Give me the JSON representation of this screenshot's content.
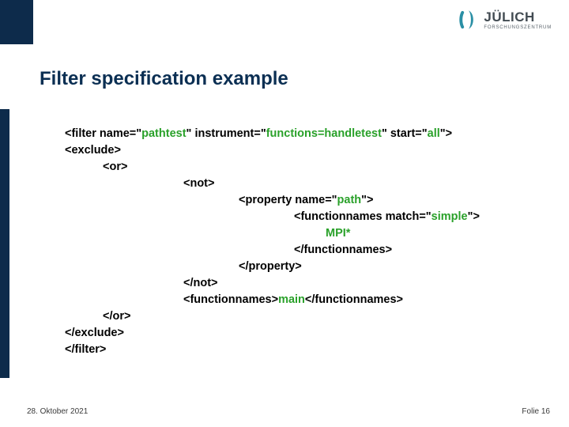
{
  "brand": {
    "name": "JÜLICH",
    "subtitle": "FORSCHUNGSZENTRUM",
    "accent_color": "#0d2b4b",
    "logo_color": "#2a8fa5"
  },
  "title": "Filter specification example",
  "code": {
    "l01a": "<filter name=\"",
    "l01b": "pathtest",
    "l01c": "\" instrument=\"",
    "l01d": "functions=handletest",
    "l01e": "\" start=\"",
    "l01f": "all",
    "l01g": "\">",
    "l02": "<exclude>",
    "l03": "<or>",
    "l04": "<not>",
    "l05a": "<property name=\"",
    "l05b": "path",
    "l05c": "\">",
    "l06a": "<functionnames match=\"",
    "l06b": "simple",
    "l06c": "\">",
    "l07": "MPI*",
    "l08": "</functionnames>",
    "l09": "</property>",
    "l10": "</not>",
    "l11a": "<functionnames>",
    "l11b": "main",
    "l11c": "</functionnames>",
    "l12": "</or>",
    "l13": "</exclude>",
    "l14": "</filter>"
  },
  "footer": {
    "date": "28. Oktober 2021",
    "page": "Folie 16"
  }
}
